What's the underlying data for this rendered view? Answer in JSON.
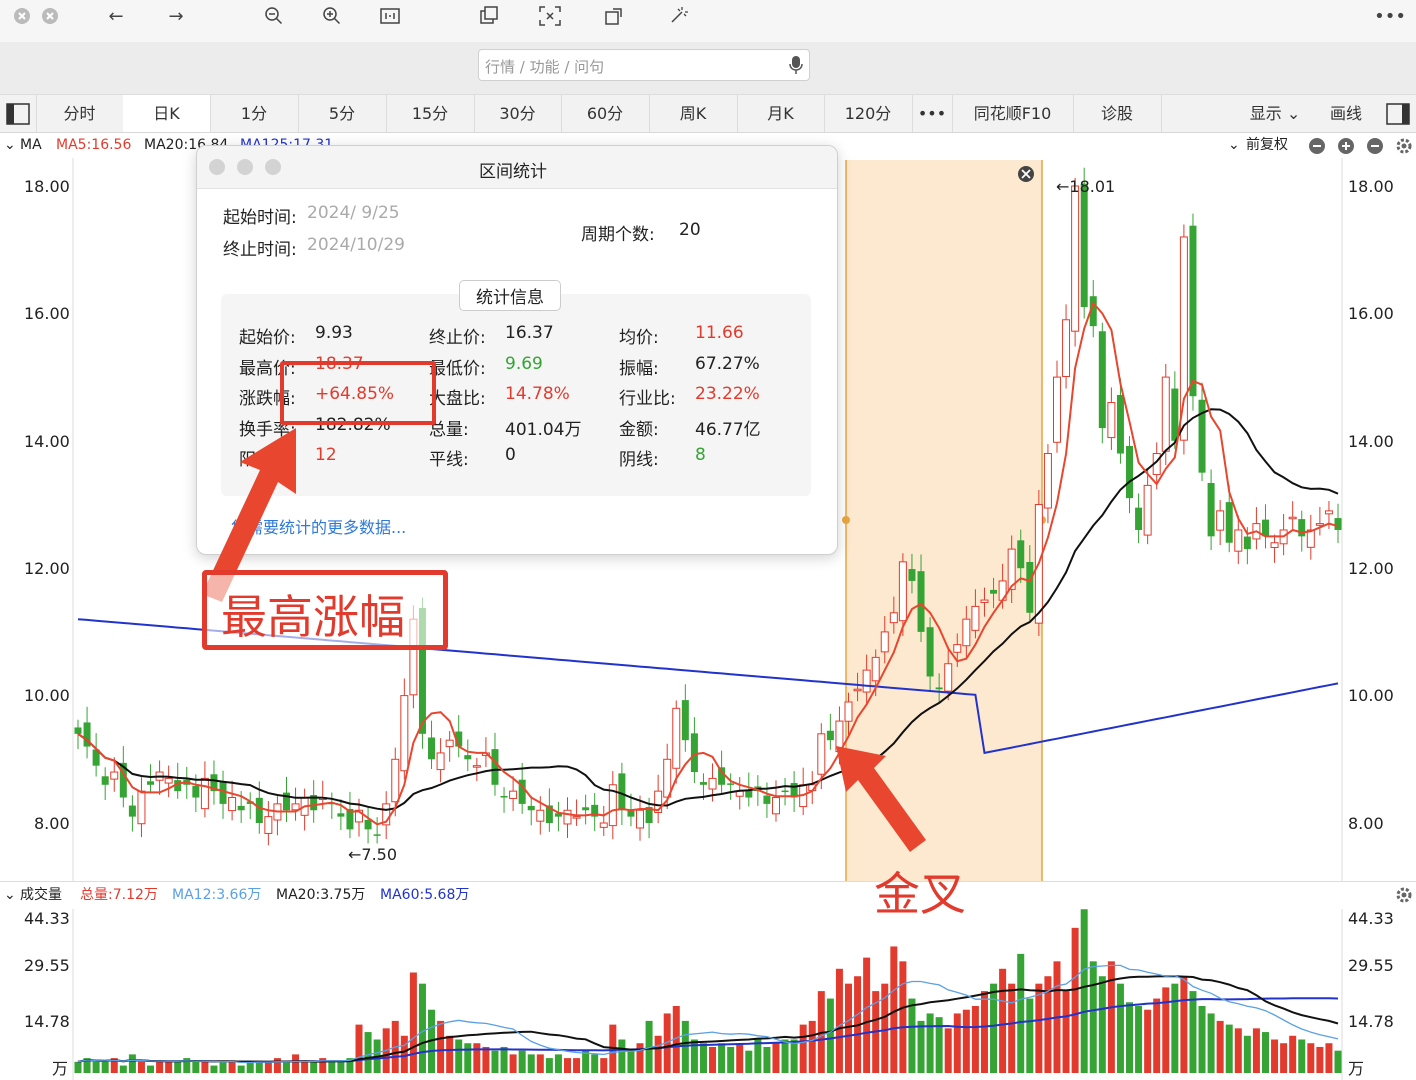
{
  "toolbar": {
    "more": "•••"
  },
  "search": {
    "placeholder": "行情 / 功能 / 问句"
  },
  "tabs": [
    "分时",
    "日K",
    "1分",
    "5分",
    "15分",
    "30分",
    "60分",
    "周K",
    "月K",
    "120分",
    "•••",
    "同花顺F10",
    "诊股"
  ],
  "tabs_right": {
    "display": "显示",
    "draw": "画线"
  },
  "ma_bar": {
    "label": "MA",
    "ma5": "MA5:16.56",
    "ma20": "MA20:16.84",
    "ma125": "MA125:17.31",
    "fuquan": "前复权"
  },
  "popup": {
    "title": "区间统计",
    "start_label": "起始时间:",
    "start_value": "2024/  9/25",
    "end_label": "终止时间:",
    "end_value": "2024/10/29",
    "period_label": "周期个数:",
    "period_value": "20",
    "section": "统计信息",
    "rows": [
      [
        {
          "label": "起始价:",
          "value": "9.93",
          "c": "black"
        },
        {
          "label": "终止价:",
          "value": "16.37",
          "c": "black"
        },
        {
          "label": "均价:",
          "value": "11.66",
          "c": "red"
        }
      ],
      [
        {
          "label": "最高价:",
          "value": "18.37",
          "c": "red"
        },
        {
          "label": "最低价:",
          "value": "9.69",
          "c": "green"
        },
        {
          "label": "振幅:",
          "value": "67.27%",
          "c": "black"
        }
      ],
      [
        {
          "label": "涨跌幅:",
          "value": "+64.85%",
          "c": "red"
        },
        {
          "label": "大盘比:",
          "value": "14.78%",
          "c": "red"
        },
        {
          "label": "行业比:",
          "value": "23.22%",
          "c": "red"
        }
      ],
      [
        {
          "label": "换手率:",
          "value": "182.82%",
          "c": "black"
        },
        {
          "label": "总量:",
          "value": "401.04万",
          "c": "black"
        },
        {
          "label": "金额:",
          "value": "46.77亿",
          "c": "black"
        }
      ],
      [
        {
          "label": "阳线:",
          "value": "12",
          "c": "red"
        },
        {
          "label": "平线:",
          "value": "0",
          "c": "black"
        },
        {
          "label": "阴线:",
          "value": "8",
          "c": "green"
        }
      ]
    ],
    "link": "您需要统计的更多数据..."
  },
  "price_axis": [
    "18.00",
    "16.00",
    "14.00",
    "12.00",
    "10.00",
    "8.00"
  ],
  "chart_labels": {
    "high": "←18.01",
    "low": "←7.50"
  },
  "annotations": {
    "max_rise": "最高涨幅",
    "golden_cross": "金叉"
  },
  "volume_bar": {
    "label": "成交量",
    "total": "总量:7.12万",
    "ma12": "MA12:3.66万",
    "ma20": "MA20:3.75万",
    "ma60": "MA60:5.68万"
  },
  "volume_axis": [
    "44.33",
    "29.55",
    "14.78",
    "万"
  ],
  "colors": {
    "up": "#e23b2e",
    "down": "#36a335",
    "ma5": "#e8462e",
    "ma20": "#111111",
    "ma125": "#2233cc",
    "highlight": "#fde9cf"
  },
  "chart_data": {
    "type": "candlestick",
    "y_range": [
      7.0,
      18.5
    ],
    "volume_range": [
      0,
      44.33
    ],
    "closes": [
      9.4,
      9.2,
      8.9,
      8.6,
      8.8,
      8.4,
      8.1,
      8.5,
      8.6,
      8.8,
      8.7,
      8.5,
      8.6,
      8.4,
      8.7,
      8.5,
      8.3,
      8.4,
      8.2,
      8.3,
      8.0,
      8.1,
      8.3,
      8.2,
      8.3,
      8.4,
      8.2,
      8.4,
      8.3,
      8.1,
      7.9,
      8.2,
      7.9,
      7.8,
      8.3,
      9.0,
      10.0,
      11.2,
      9.4,
      9.0,
      9.1,
      9.3,
      9.2,
      9.0,
      8.9,
      9.1,
      8.6,
      8.4,
      8.5,
      8.3,
      8.2,
      8.2,
      8.0,
      8.1,
      8.2,
      8.1,
      8.2,
      8.1,
      8.0,
      8.6,
      8.2,
      8.1,
      8.2,
      8.0,
      8.5,
      9.0,
      9.8,
      9.3,
      8.8,
      8.6,
      8.7,
      8.6,
      8.6,
      8.5,
      8.4,
      8.5,
      8.3,
      8.4,
      8.5,
      8.4,
      8.6,
      8.6,
      9.4,
      9.3,
      9.6,
      9.9,
      10.1,
      10.4,
      10.6,
      11.0,
      11.3,
      12.1,
      11.8,
      11.0,
      10.3,
      10.1,
      10.5,
      10.8,
      11.2,
      11.4,
      11.5,
      11.6,
      11.8,
      12.3,
      12.0,
      11.3,
      13.0,
      13.8,
      15.0,
      15.9,
      18.0,
      16.1,
      15.8,
      14.2,
      14.6,
      13.8,
      13.1,
      12.6,
      13.3,
      13.8,
      15.0,
      14.0,
      17.2,
      14.7,
      13.5,
      12.5,
      12.9,
      12.4,
      12.6,
      12.3,
      12.7,
      12.5,
      12.4,
      12.6,
      12.8,
      12.5,
      12.6,
      12.7,
      12.9,
      12.6
    ],
    "volumes": [
      3,
      4,
      3,
      3,
      4,
      2,
      5,
      3,
      2,
      3,
      3,
      3,
      4,
      3,
      3,
      2,
      3,
      3,
      2,
      3,
      3,
      3,
      4,
      3,
      5,
      3,
      3,
      4,
      3,
      3,
      4,
      13,
      11,
      9,
      12,
      14,
      10,
      27,
      24,
      17,
      14,
      10,
      9,
      8,
      8,
      7,
      6,
      7,
      5,
      6,
      5,
      5,
      4,
      5,
      4,
      4,
      6,
      5,
      4,
      13,
      9,
      6,
      8,
      14,
      10,
      16,
      18,
      14,
      9,
      8,
      7,
      8,
      7,
      8,
      6,
      9,
      7,
      8,
      9,
      9,
      13,
      14,
      22,
      20,
      28,
      24,
      26,
      31,
      22,
      24,
      34,
      30,
      20,
      14,
      16,
      15,
      12,
      16,
      17,
      18,
      22,
      24,
      28,
      24,
      32,
      20,
      24,
      26,
      30,
      22,
      39,
      44,
      30,
      26,
      30,
      24,
      19,
      18,
      17,
      20,
      23,
      24,
      26,
      22,
      18,
      16,
      14,
      13,
      12,
      10,
      12,
      11,
      9,
      8,
      10,
      9,
      8,
      7,
      8,
      6
    ]
  }
}
